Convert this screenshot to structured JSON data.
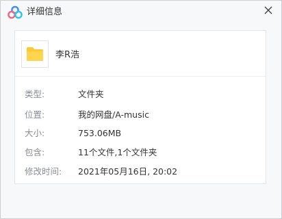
{
  "window": {
    "title": "详细信息"
  },
  "file": {
    "name": "李R浩",
    "icon": "folder-icon"
  },
  "details": [
    {
      "label": "类型:",
      "value": "文件夹"
    },
    {
      "label": "位置:",
      "value": "我的网盘/A-music"
    },
    {
      "label": "大小:",
      "value": "753.06MB"
    },
    {
      "label": "包含:",
      "value": "11个文件,1个文件夹"
    },
    {
      "label": "修改时间:",
      "value": "2021年05月16日, 20:02"
    }
  ],
  "colors": {
    "folder": "#ffc933",
    "logo_blue": "#3b8cf6",
    "logo_pink": "#f4637c",
    "logo_cyan": "#2ec6e8"
  }
}
